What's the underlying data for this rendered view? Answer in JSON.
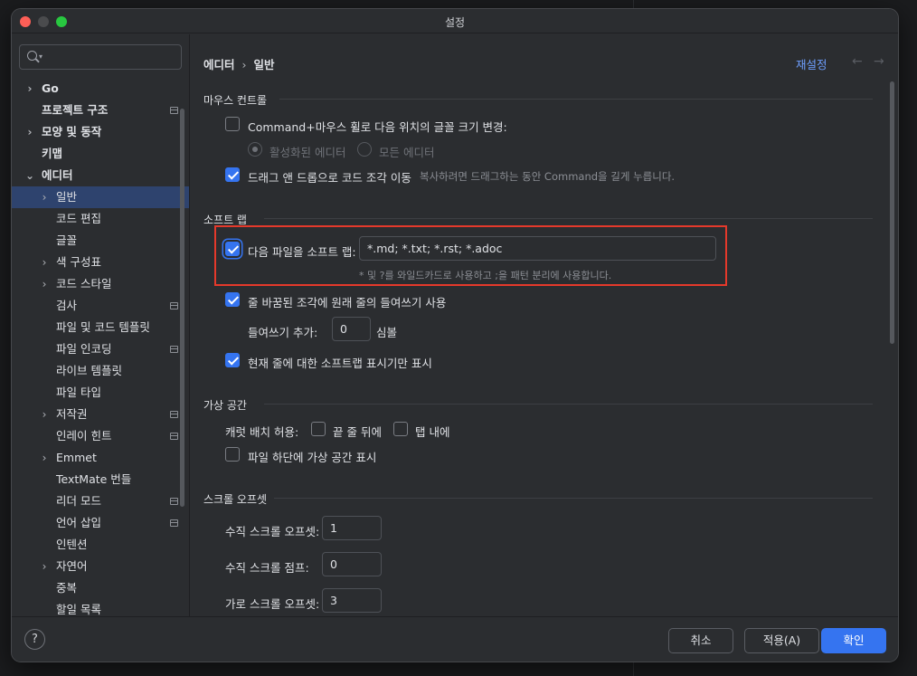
{
  "window": {
    "title": "설정"
  },
  "search": {
    "placeholder": ""
  },
  "sidebar": {
    "items": [
      {
        "label": "Go",
        "chevron": true,
        "bold": true,
        "level": 0
      },
      {
        "label": "프로젝트 구조",
        "bold": true,
        "level": 0,
        "page_icon": true
      },
      {
        "label": "모양 및 동작",
        "chevron": true,
        "bold": true,
        "level": 0
      },
      {
        "label": "키맵",
        "bold": true,
        "level": 0
      },
      {
        "label": "에디터",
        "chevron": true,
        "expanded": true,
        "bold": true,
        "level": 0
      },
      {
        "label": "일반",
        "chevron": true,
        "level": 1,
        "selected": true
      },
      {
        "label": "코드 편집",
        "level": 1
      },
      {
        "label": "글꼴",
        "level": 1
      },
      {
        "label": "색 구성표",
        "chevron": true,
        "level": 1
      },
      {
        "label": "코드 스타일",
        "chevron": true,
        "level": 1
      },
      {
        "label": "검사",
        "level": 1,
        "page_icon": true
      },
      {
        "label": "파일 및 코드 템플릿",
        "level": 1
      },
      {
        "label": "파일 인코딩",
        "level": 1,
        "page_icon": true
      },
      {
        "label": "라이브 템플릿",
        "level": 1
      },
      {
        "label": "파일 타입",
        "level": 1
      },
      {
        "label": "저작권",
        "chevron": true,
        "level": 1,
        "page_icon": true
      },
      {
        "label": "인레이 힌트",
        "level": 1,
        "page_icon": true
      },
      {
        "label": "Emmet",
        "chevron": true,
        "level": 1
      },
      {
        "label": "TextMate 번들",
        "level": 1
      },
      {
        "label": "리더 모드",
        "level": 1,
        "page_icon": true
      },
      {
        "label": "언어 삽입",
        "level": 1,
        "page_icon": true
      },
      {
        "label": "인텐션",
        "level": 1
      },
      {
        "label": "자연어",
        "chevron": true,
        "level": 1
      },
      {
        "label": "중복",
        "level": 1
      },
      {
        "label": "할일 목록",
        "level": 1
      }
    ]
  },
  "header": {
    "breadcrumb_parent": "에디터",
    "breadcrumb_sep": "›",
    "breadcrumb_current": "일반",
    "reset_label": "재설정",
    "back_arrow": "←",
    "forward_arrow": "→"
  },
  "mouse_control": {
    "title": "마우스 컨트롤",
    "zoom_label": "Command+마우스 휠로 다음 위치의 글꼴 크기 변경:",
    "zoom_checked": false,
    "radio_active": "활성화된 에디터",
    "radio_all": "모든 에디터",
    "dnd_label": "드래그 앤 드롭으로 코드 조각 이동",
    "dnd_checked": true,
    "dnd_hint": "복사하려면 드래그하는 동안 Command을 길게 누릅니다."
  },
  "soft_wrap": {
    "title": "소프트 랩",
    "files_label": "다음 파일을 소프트 랩:",
    "files_checked": true,
    "files_value": "*.md; *.txt; *.rst; *.adoc",
    "files_hint": "* 및 ?를 와일드카드로 사용하고 ;을 패턴 분리에 사용합니다.",
    "indent_label": "줄 바꿈된 조각에 원래 줄의 들여쓰기 사용",
    "indent_checked": true,
    "indent_add_label": "들여쓰기 추가:",
    "indent_add_value": "0",
    "indent_unit": "심볼",
    "current_line_label": "현재 줄에 대한 소프트랩 표시기만 표시",
    "current_line_checked": true
  },
  "virtual_space": {
    "title": "가상 공간",
    "caret_label": "캐럿 배치 허용:",
    "end_of_line": "끝 줄 뒤에",
    "inside_tab": "탭 내에",
    "bottom_label": "파일 하단에 가상 공간 표시"
  },
  "scroll_offset": {
    "title": "스크롤 오프셋",
    "vertical_offset_label": "수직 스크롤 오프셋:",
    "vertical_offset_value": "1",
    "vertical_jump_label": "수직 스크롤 점프:",
    "vertical_jump_value": "0",
    "horizontal_offset_label": "가로 스크롤 오프셋:",
    "horizontal_offset_value": "3"
  },
  "footer": {
    "help": "?",
    "cancel": "취소",
    "apply": "적용(A)",
    "ok": "확인"
  },
  "colors": {
    "accent": "#3574f0",
    "link": "#6e9fff",
    "highlight": "#e5392b",
    "selection": "#2e436e"
  }
}
